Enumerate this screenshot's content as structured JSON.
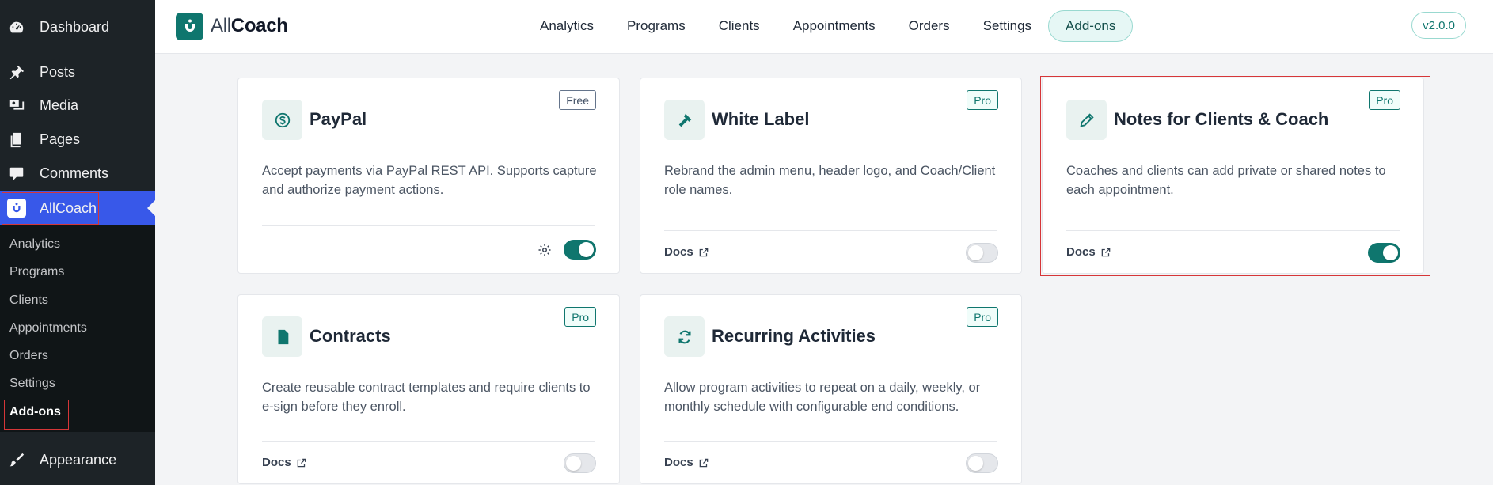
{
  "sidebar": {
    "dashboard": "Dashboard",
    "posts": "Posts",
    "media": "Media",
    "pages": "Pages",
    "comments": "Comments",
    "allcoach": "AllCoach",
    "submenu": [
      "Analytics",
      "Programs",
      "Clients",
      "Appointments",
      "Orders",
      "Settings",
      "Add-ons"
    ],
    "active_submenu": "Add-ons",
    "appearance": "Appearance"
  },
  "header": {
    "brand_part1": "All",
    "brand_part2": "Coach",
    "nav": [
      "Analytics",
      "Programs",
      "Clients",
      "Appointments",
      "Orders",
      "Settings",
      "Add-ons"
    ],
    "active_nav": "Add-ons",
    "version": "v2.0.0"
  },
  "addons": [
    {
      "title": "PayPal",
      "badge": "Free",
      "description": "Accept payments via PayPal REST API. Supports capture and authorize payment actions.",
      "enabled": true,
      "has_settings": true,
      "icon": "dollar-icon"
    },
    {
      "title": "White Label",
      "badge": "Pro",
      "description": "Rebrand the admin menu, header logo, and Coach/Client role names.",
      "docs_label": "Docs",
      "enabled": false,
      "icon": "hammer-icon"
    },
    {
      "title": "Notes for Clients & Coach",
      "badge": "Pro",
      "description": "Coaches and clients can add private or shared notes to each appointment.",
      "docs_label": "Docs",
      "enabled": true,
      "icon": "pencil-icon"
    },
    {
      "title": "Contracts",
      "badge": "Pro",
      "description": "Create reusable contract templates and require clients to e-sign before they enroll.",
      "docs_label": "Docs",
      "enabled": false,
      "icon": "document-icon"
    },
    {
      "title": "Recurring Activities",
      "badge": "Pro",
      "description": "Allow program activities to repeat on a daily, weekly, or monthly schedule with configurable end conditions.",
      "docs_label": "Docs",
      "enabled": false,
      "icon": "refresh-icon"
    }
  ],
  "colors": {
    "accent": "#0f766e",
    "wp_sidebar": "#1d2327",
    "wp_active": "#3858e9",
    "highlight": "#d63638"
  }
}
